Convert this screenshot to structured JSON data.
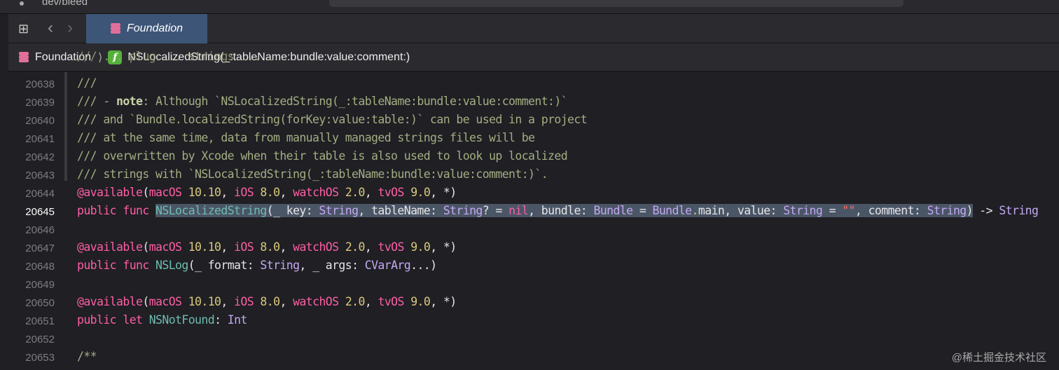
{
  "window": {
    "branch": "dev/bleed"
  },
  "tab": {
    "label": "Foundation"
  },
  "breadcrumb": {
    "module": "Foundation",
    "separator": "⟩",
    "symbol_badge": "f",
    "symbol": "NSLocalizedString(_:tableName:bundle:value:comment:)"
  },
  "lines": [
    {
      "n": "",
      "text": "/// ... plug ... strings ... ."
    },
    {
      "n": "20638",
      "text": "///"
    },
    {
      "n": "20639",
      "text": "/// - note: Although `NSLocalizedString(_:tableName:bundle:value:comment:)`"
    },
    {
      "n": "20640",
      "text": "/// and `Bundle.localizedString(forKey:value:table:)` can be used in a project"
    },
    {
      "n": "20641",
      "text": "/// at the same time, data from manually managed strings files will be"
    },
    {
      "n": "20642",
      "text": "/// overwritten by Xcode when their table is also used to look up localized"
    },
    {
      "n": "20643",
      "text": "/// strings with `NSLocalizedString(_:tableName:bundle:value:comment:)`."
    },
    {
      "n": "20644",
      "text": "@available(macOS 10.10, iOS 8.0, watchOS 2.0, tvOS 9.0, *)"
    },
    {
      "n": "20645",
      "text": "public func NSLocalizedString(_ key: String, tableName: String? = nil, bundle: Bundle = Bundle.main, value: String = \"\", comment: String) -> String"
    },
    {
      "n": "20646",
      "text": ""
    },
    {
      "n": "20647",
      "text": "@available(macOS 10.10, iOS 8.0, watchOS 2.0, tvOS 9.0, *)"
    },
    {
      "n": "20648",
      "text": "public func NSLog(_ format: String, _ args: CVarArg...)"
    },
    {
      "n": "20649",
      "text": ""
    },
    {
      "n": "20650",
      "text": "@available(macOS 10.10, iOS 8.0, watchOS 2.0, tvOS 9.0, *)"
    },
    {
      "n": "20651",
      "text": "public let NSNotFound: Int"
    },
    {
      "n": "20652",
      "text": ""
    },
    {
      "n": "20653",
      "text": "/**"
    }
  ],
  "current_line": "20645",
  "watermark": "@稀土掘金技术社区"
}
